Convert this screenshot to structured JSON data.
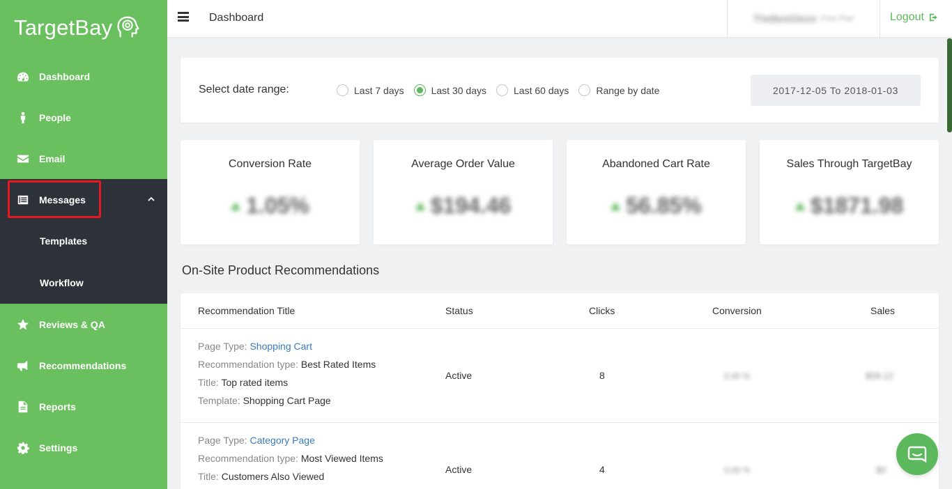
{
  "app": {
    "brand": "TargetBay"
  },
  "sidebar": {
    "items": [
      {
        "label": "Dashboard",
        "icon": "speedometer-icon"
      },
      {
        "label": "People",
        "icon": "person-icon"
      },
      {
        "label": "Email",
        "icon": "envelope-icon"
      },
      {
        "label": "Messages",
        "icon": "list-icon"
      },
      {
        "label": "Reviews & QA",
        "icon": "star-icon"
      },
      {
        "label": "Recommendations",
        "icon": "megaphone-icon"
      },
      {
        "label": "Reports",
        "icon": "document-icon"
      },
      {
        "label": "Settings",
        "icon": "gear-icon"
      }
    ],
    "submenu": [
      {
        "label": "Templates"
      },
      {
        "label": "Workflow"
      }
    ]
  },
  "header": {
    "breadcrumb": "Dashboard",
    "user_name": "TheBestStore",
    "user_sub": "Free Plan",
    "logout_label": "Logout"
  },
  "date_filter": {
    "label": "Select date range:",
    "options": [
      "Last 7 days",
      "Last 30 days",
      "Last 60 days",
      "Range by date"
    ],
    "selected": "Last 30 days",
    "range_text": "2017-12-05 To 2018-01-03"
  },
  "stats": [
    {
      "title": "Conversion Rate",
      "value": "1.05%"
    },
    {
      "title": "Average Order Value",
      "value": "$194.46"
    },
    {
      "title": "Abandoned Cart Rate",
      "value": "56.85%"
    },
    {
      "title": "Sales Through TargetBay",
      "value": "$1871.98"
    }
  ],
  "recommendations": {
    "title": "On-Site Product Recommendations",
    "columns": [
      "Recommendation Title",
      "Status",
      "Clicks",
      "Conversion",
      "Sales"
    ],
    "field_labels": {
      "page_type": "Page Type:",
      "rec_type": "Recommendation type:",
      "title": "Title:",
      "template": "Template:"
    },
    "rows": [
      {
        "page_type": "Shopping Cart",
        "rec_type": "Best Rated Items",
        "title": "Top rated items",
        "template": "Shopping Cart Page",
        "status": "Active",
        "clicks": "8",
        "conversion": "0.00 %",
        "sales": "$58.12"
      },
      {
        "page_type": "Category Page",
        "rec_type": "Most Viewed Items",
        "title": "Customers Also Viewed",
        "status": "Active",
        "clicks": "4",
        "conversion": "0.00 %",
        "sales": "$0"
      }
    ]
  },
  "colors": {
    "sidebar": "#6abf5f",
    "sidebar_dark": "#2d3139",
    "accent": "#5cb85c",
    "highlight": "#e8191e",
    "link": "#3a7ab8"
  }
}
